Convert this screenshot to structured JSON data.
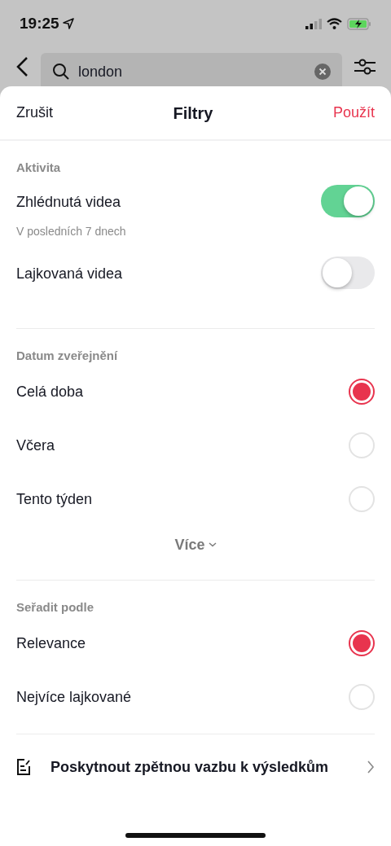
{
  "status_bar": {
    "time": "19:25"
  },
  "search": {
    "value": "london"
  },
  "sheet": {
    "cancel": "Zrušit",
    "title": "Filtry",
    "apply": "Použít"
  },
  "activity": {
    "heading": "Aktivita",
    "toggles": [
      {
        "label": "Zhlédnutá videa",
        "subtitle": "V posledních 7 dnech",
        "on": true
      },
      {
        "label": "Lajkovaná videa",
        "on": false
      }
    ]
  },
  "date": {
    "heading": "Datum zveřejnění",
    "options": [
      {
        "label": "Celá doba",
        "selected": true
      },
      {
        "label": "Včera",
        "selected": false
      },
      {
        "label": "Tento týden",
        "selected": false
      }
    ],
    "more": "Více"
  },
  "sort": {
    "heading": "Seřadit podle",
    "options": [
      {
        "label": "Relevance",
        "selected": true
      },
      {
        "label": "Nejvíce lajkované",
        "selected": false
      }
    ]
  },
  "feedback": {
    "label": "Poskytnout zpětnou vazbu k výsledkům"
  }
}
